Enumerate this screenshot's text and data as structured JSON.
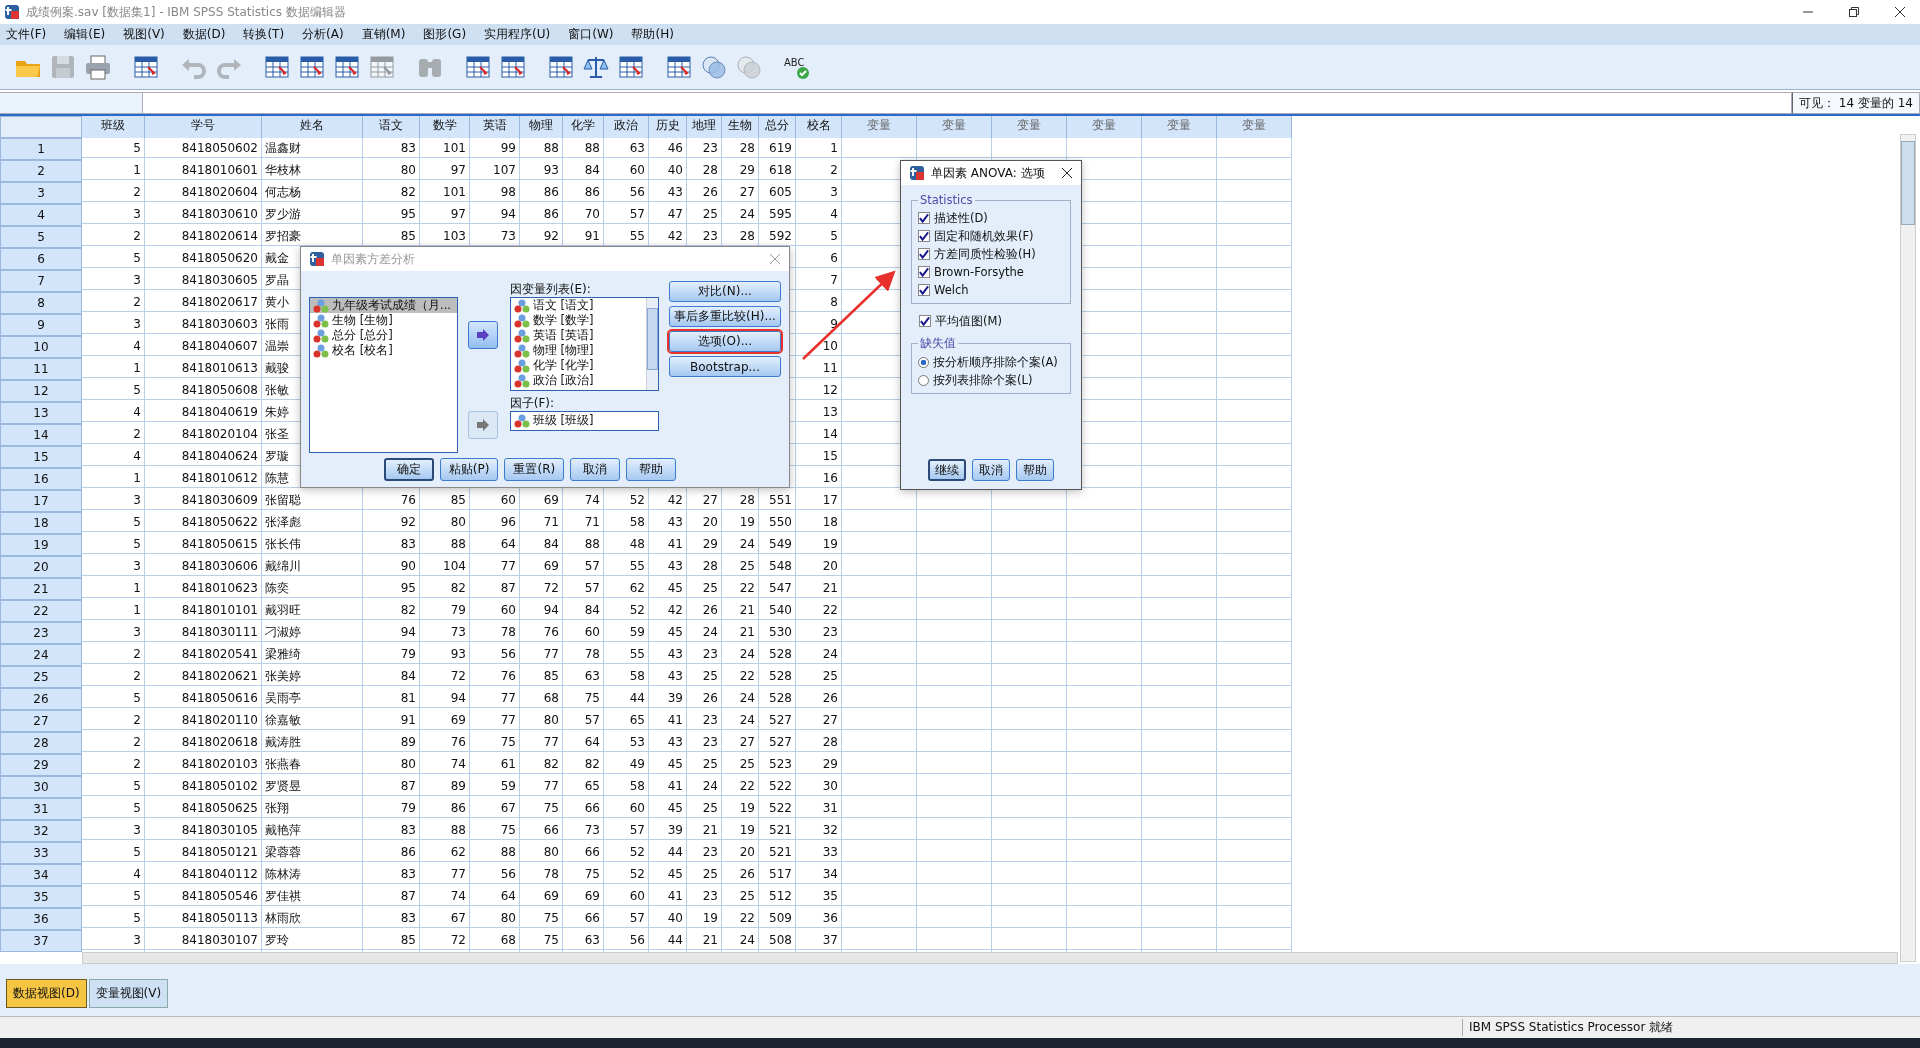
{
  "window": {
    "title": "成绩例案.sav [数据集1] - IBM SPSS Statistics 数据编辑器"
  },
  "menu": [
    "文件(F)",
    "编辑(E)",
    "视图(V)",
    "数据(D)",
    "转换(T)",
    "分析(A)",
    "直销(M)",
    "图形(G)",
    "实用程序(U)",
    "窗口(W)",
    "帮助(H)"
  ],
  "toolbar": [
    [
      {
        "kind": "folder",
        "disabled": false
      },
      {
        "kind": "floppy",
        "disabled": true
      },
      {
        "kind": "printer",
        "disabled": false
      }
    ],
    [
      {
        "kind": "grid",
        "disabled": false
      }
    ],
    [
      {
        "kind": "undo",
        "disabled": true
      },
      {
        "kind": "redo",
        "disabled": true
      }
    ],
    [
      {
        "kind": "grid",
        "disabled": false
      },
      {
        "kind": "grid",
        "disabled": false
      },
      {
        "kind": "grid",
        "disabled": false
      },
      {
        "kind": "grid",
        "disabled": true
      }
    ],
    [
      {
        "kind": "binoculars",
        "disabled": true
      }
    ],
    [
      {
        "kind": "grid",
        "disabled": false
      },
      {
        "kind": "grid",
        "disabled": false
      }
    ],
    [
      {
        "kind": "grid",
        "disabled": false
      },
      {
        "kind": "scale",
        "disabled": false
      },
      {
        "kind": "grid",
        "disabled": false
      }
    ],
    [
      {
        "kind": "grid",
        "disabled": false
      },
      {
        "kind": "circles",
        "disabled": false
      },
      {
        "kind": "circles",
        "disabled": true
      }
    ],
    [
      {
        "kind": "spellcheck",
        "disabled": false,
        "label": "ABC"
      }
    ]
  ],
  "visible_count": "可见： 14 变量的 14",
  "table": {
    "columns": [
      "班级",
      "学号",
      "姓名",
      "语文",
      "数学",
      "英语",
      "物理",
      "化学",
      "政治",
      "历史",
      "地理",
      "生物",
      "总分",
      "校名",
      "变量",
      "变量",
      "变量",
      "变量",
      "变量",
      "变量"
    ],
    "rows": [
      {
        "row": "1",
        "cells": [
          "5",
          "8418050602",
          "温鑫财",
          "83",
          "101",
          "99",
          "88",
          "88",
          "63",
          "46",
          "23",
          "28",
          "619",
          "1"
        ]
      },
      {
        "row": "2",
        "cells": [
          "1",
          "8418010601",
          "华枝林",
          "80",
          "97",
          "107",
          "93",
          "84",
          "60",
          "40",
          "28",
          "29",
          "618",
          "2"
        ]
      },
      {
        "row": "3",
        "cells": [
          "2",
          "8418020604",
          "何志杨",
          "82",
          "101",
          "98",
          "86",
          "86",
          "56",
          "43",
          "26",
          "27",
          "605",
          "3"
        ]
      },
      {
        "row": "4",
        "cells": [
          "3",
          "8418030610",
          "罗少游",
          "95",
          "97",
          "94",
          "86",
          "70",
          "57",
          "47",
          "25",
          "24",
          "595",
          "4"
        ]
      },
      {
        "row": "5",
        "cells": [
          "2",
          "8418020614",
          "罗招豪",
          "85",
          "103",
          "73",
          "92",
          "91",
          "55",
          "42",
          "23",
          "28",
          "592",
          "5"
        ]
      },
      {
        "row": "6",
        "cells": [
          "5",
          "8418050620",
          "戴金",
          null,
          null,
          null,
          null,
          null,
          null,
          null,
          null,
          null,
          null,
          "6"
        ]
      },
      {
        "row": "7",
        "cells": [
          "3",
          "8418030605",
          "罗晶",
          null,
          null,
          null,
          null,
          null,
          null,
          null,
          null,
          null,
          null,
          "7"
        ]
      },
      {
        "row": "8",
        "cells": [
          "2",
          "8418020617",
          "黄小",
          null,
          null,
          null,
          null,
          null,
          null,
          null,
          null,
          null,
          null,
          "8"
        ]
      },
      {
        "row": "9",
        "cells": [
          "3",
          "8418030603",
          "张雨",
          null,
          null,
          null,
          null,
          null,
          null,
          null,
          null,
          null,
          null,
          "9"
        ]
      },
      {
        "row": "10",
        "cells": [
          "4",
          "8418040607",
          "温崇",
          null,
          null,
          null,
          null,
          null,
          null,
          null,
          null,
          null,
          null,
          "10"
        ]
      },
      {
        "row": "11",
        "cells": [
          "1",
          "8418010613",
          "戴骏",
          null,
          null,
          null,
          null,
          null,
          null,
          null,
          null,
          null,
          null,
          "11"
        ]
      },
      {
        "row": "12",
        "cells": [
          "5",
          "8418050608",
          "张敏",
          null,
          null,
          null,
          null,
          null,
          null,
          null,
          null,
          null,
          null,
          "12"
        ]
      },
      {
        "row": "13",
        "cells": [
          "4",
          "8418040619",
          "朱婷",
          null,
          null,
          null,
          null,
          null,
          null,
          null,
          null,
          null,
          null,
          "13"
        ]
      },
      {
        "row": "14",
        "cells": [
          "2",
          "8418020104",
          "张圣",
          null,
          null,
          null,
          null,
          null,
          null,
          null,
          null,
          null,
          null,
          "14"
        ]
      },
      {
        "row": "15",
        "cells": [
          "4",
          "8418040624",
          "罗璇",
          null,
          null,
          null,
          null,
          null,
          null,
          null,
          null,
          null,
          null,
          "15"
        ]
      },
      {
        "row": "16",
        "cells": [
          "1",
          "8418010612",
          "陈慧",
          null,
          null,
          null,
          null,
          null,
          null,
          null,
          null,
          null,
          null,
          "16"
        ]
      },
      {
        "row": "17",
        "cells": [
          "3",
          "8418030609",
          "张留聪",
          "76",
          "85",
          "60",
          "69",
          "74",
          "52",
          "42",
          "27",
          "28",
          "551",
          "17"
        ]
      },
      {
        "row": "18",
        "cells": [
          "5",
          "8418050622",
          "张泽彪",
          "92",
          "80",
          "96",
          "71",
          "71",
          "58",
          "43",
          "20",
          "19",
          "550",
          "18"
        ]
      },
      {
        "row": "19",
        "cells": [
          "5",
          "8418050615",
          "张长伟",
          "83",
          "88",
          "64",
          "84",
          "88",
          "48",
          "41",
          "29",
          "24",
          "549",
          "19"
        ]
      },
      {
        "row": "20",
        "cells": [
          "3",
          "8418030606",
          "戴绵川",
          "90",
          "104",
          "77",
          "69",
          "57",
          "55",
          "43",
          "28",
          "25",
          "548",
          "20"
        ]
      },
      {
        "row": "21",
        "cells": [
          "1",
          "8418010623",
          "陈奕",
          "95",
          "82",
          "87",
          "72",
          "57",
          "62",
          "45",
          "25",
          "22",
          "547",
          "21"
        ]
      },
      {
        "row": "22",
        "cells": [
          "1",
          "8418010101",
          "戴羽旺",
          "82",
          "79",
          "60",
          "94",
          "84",
          "52",
          "42",
          "26",
          "21",
          "540",
          "22"
        ]
      },
      {
        "row": "23",
        "cells": [
          "3",
          "8418030111",
          "刁淑婷",
          "94",
          "73",
          "78",
          "76",
          "60",
          "59",
          "45",
          "24",
          "21",
          "530",
          "23"
        ]
      },
      {
        "row": "24",
        "cells": [
          "2",
          "8418020541",
          "梁雅绮",
          "79",
          "93",
          "56",
          "77",
          "78",
          "55",
          "43",
          "23",
          "24",
          "528",
          "24"
        ]
      },
      {
        "row": "25",
        "cells": [
          "2",
          "8418020621",
          "张美婷",
          "84",
          "72",
          "76",
          "85",
          "63",
          "58",
          "43",
          "25",
          "22",
          "528",
          "25"
        ]
      },
      {
        "row": "26",
        "cells": [
          "5",
          "8418050616",
          "吴雨亭",
          "81",
          "94",
          "77",
          "68",
          "75",
          "44",
          "39",
          "26",
          "24",
          "528",
          "26"
        ]
      },
      {
        "row": "27",
        "cells": [
          "2",
          "8418020110",
          "徐嘉敏",
          "91",
          "69",
          "77",
          "80",
          "57",
          "65",
          "41",
          "23",
          "24",
          "527",
          "27"
        ]
      },
      {
        "row": "28",
        "cells": [
          "2",
          "8418020618",
          "戴涛胜",
          "89",
          "76",
          "75",
          "77",
          "64",
          "53",
          "43",
          "23",
          "27",
          "527",
          "28"
        ]
      },
      {
        "row": "29",
        "cells": [
          "2",
          "8418020103",
          "张燕春",
          "80",
          "74",
          "61",
          "82",
          "82",
          "49",
          "45",
          "25",
          "25",
          "523",
          "29"
        ]
      },
      {
        "row": "30",
        "cells": [
          "5",
          "8418050102",
          "罗贤昱",
          "87",
          "89",
          "59",
          "77",
          "65",
          "58",
          "41",
          "24",
          "22",
          "522",
          "30"
        ]
      },
      {
        "row": "31",
        "cells": [
          "5",
          "8418050625",
          "张翔",
          "79",
          "86",
          "67",
          "75",
          "66",
          "60",
          "45",
          "25",
          "19",
          "522",
          "31"
        ]
      },
      {
        "row": "32",
        "cells": [
          "3",
          "8418030105",
          "戴艳萍",
          "83",
          "88",
          "75",
          "66",
          "73",
          "57",
          "39",
          "21",
          "19",
          "521",
          "32"
        ]
      },
      {
        "row": "33",
        "cells": [
          "5",
          "8418050121",
          "梁蓉蓉",
          "86",
          "62",
          "88",
          "80",
          "66",
          "52",
          "44",
          "23",
          "20",
          "521",
          "33"
        ]
      },
      {
        "row": "34",
        "cells": [
          "4",
          "8418040112",
          "陈林涛",
          "83",
          "77",
          "56",
          "78",
          "75",
          "52",
          "45",
          "25",
          "26",
          "517",
          "34"
        ]
      },
      {
        "row": "35",
        "cells": [
          "5",
          "8418050546",
          "罗佳祺",
          "87",
          "74",
          "64",
          "69",
          "69",
          "60",
          "41",
          "23",
          "25",
          "512",
          "35"
        ]
      },
      {
        "row": "36",
        "cells": [
          "5",
          "8418050113",
          "林雨欣",
          "83",
          "67",
          "80",
          "75",
          "66",
          "57",
          "40",
          "19",
          "22",
          "509",
          "36"
        ]
      },
      {
        "row": "37",
        "cells": [
          "3",
          "8418030107",
          "罗玲",
          "85",
          "72",
          "68",
          "75",
          "63",
          "56",
          "44",
          "21",
          "24",
          "508",
          "37"
        ]
      }
    ]
  },
  "dialog": {
    "title": "单因素方差分析",
    "source_list": [
      {
        "label": "九年级考试成绩（月...",
        "selected": true
      },
      {
        "label": "生物 [生物]",
        "selected": false
      },
      {
        "label": "总分 [总分]",
        "selected": false
      },
      {
        "label": "校名 [校名]",
        "selected": false
      }
    ],
    "dependent_label": "因变量列表(E):",
    "dependent_list": [
      "语文 [语文]",
      "数学 [数学]",
      "英语 [英语]",
      "物理 [物理]",
      "化学 [化学]",
      "政治 [政治]"
    ],
    "factor_label": "因子(F):",
    "factor": "班级 [班级]",
    "move_buttons": [
      {
        "disabled": false
      },
      {
        "disabled": true
      }
    ],
    "side_buttons": [
      {
        "label": "对比(N)...",
        "highlighted": false
      },
      {
        "label": "事后多重比较(H)...",
        "highlighted": false
      },
      {
        "label": "选项(O)...",
        "highlighted": true
      },
      {
        "label": "Bootstrap...",
        "highlighted": false
      }
    ],
    "bottom_buttons": [
      {
        "label": "确定",
        "default": true
      },
      {
        "label": "粘贴(P)",
        "default": false
      },
      {
        "label": "重置(R)",
        "default": false
      },
      {
        "label": "取消",
        "default": false
      },
      {
        "label": "帮助",
        "default": false
      }
    ]
  },
  "options_dialog": {
    "title": "单因素 ANOVA: 选项",
    "statistics_label": "Statistics",
    "statistics": [
      {
        "label": "描述性(D)",
        "checked": true
      },
      {
        "label": "固定和随机效果(F)",
        "checked": true
      },
      {
        "label": "方差同质性检验(H)",
        "checked": true
      },
      {
        "label": "Brown-Forsythe",
        "checked": true
      },
      {
        "label": "Welch",
        "checked": true
      }
    ],
    "means_plot": {
      "label": "平均值图(M)",
      "checked": true
    },
    "missing_label": "缺失值",
    "missing": [
      {
        "label": "按分析顺序排除个案(A)",
        "selected": true
      },
      {
        "label": "按列表排除个案(L)",
        "selected": false
      }
    ],
    "buttons": [
      {
        "label": "继续",
        "default": true
      },
      {
        "label": "取消",
        "default": false
      },
      {
        "label": "帮助",
        "default": false
      }
    ]
  },
  "view_tabs": [
    {
      "label": "数据视图(D)",
      "selected": true
    },
    {
      "label": "变量视图(V)",
      "selected": false
    }
  ],
  "status_bar": {
    "text": "IBM SPSS Statistics Processor 就绪"
  }
}
